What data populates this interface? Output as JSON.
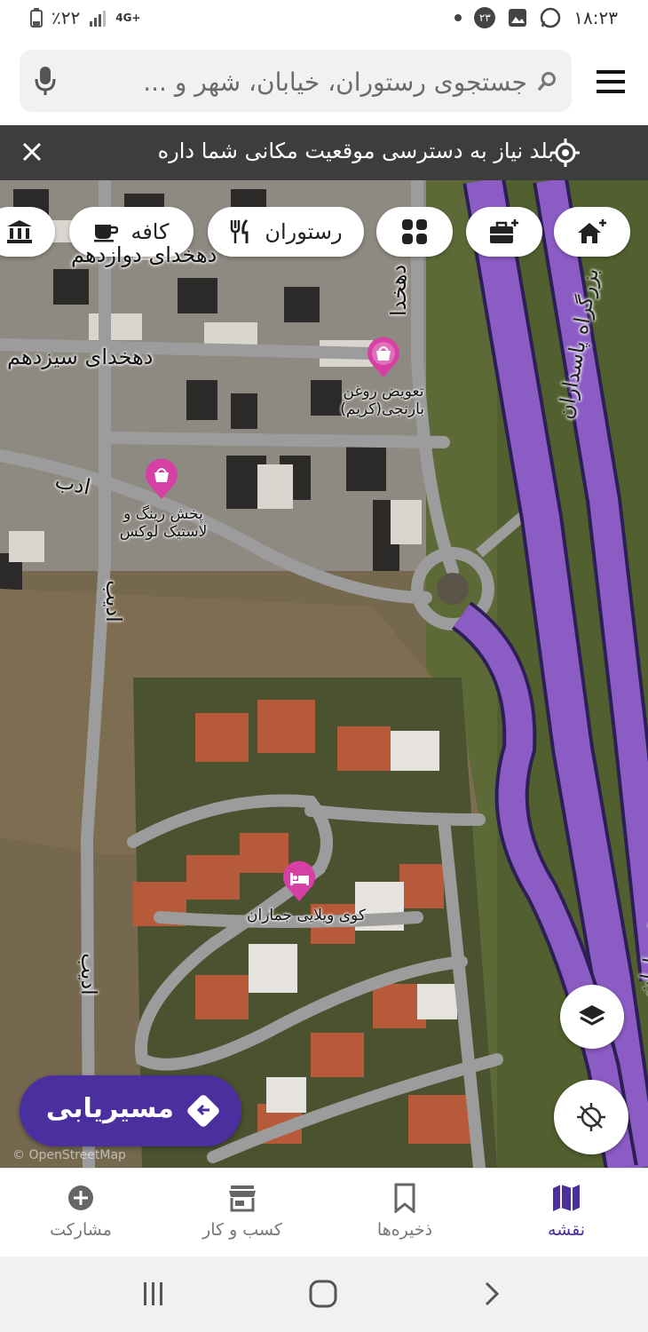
{
  "status_bar": {
    "time": "۱۸:۲۳",
    "notification_count": "۲۳",
    "battery": "٪۲۲",
    "network": "4G+"
  },
  "search": {
    "placeholder": "جستجوی رستوران، خیابان، شهر و ..."
  },
  "banner": {
    "message": "بلد نیاز به دسترسی موقعیت مکانی شما داره"
  },
  "categories": [
    {
      "label": "کافه",
      "icon": "coffee-icon"
    },
    {
      "label": "رستوران",
      "icon": "fork-knife-icon"
    }
  ],
  "map": {
    "labels": {
      "dehkhoda_13": "دهخدای سیزدهم",
      "dehkhoda_partial": "دهخدای دوازدهم",
      "dehkhoda_vertical": "دهخدا",
      "adab": "ادب",
      "adib1": "ادیب",
      "adib2": "ادیب",
      "highway": "بزرگراه پاسداران",
      "highway_right": "پاسداران"
    },
    "pois": [
      {
        "name": "تعویض روغن بارنجی(کریم)",
        "type": "shop"
      },
      {
        "name": "پخش رینگ و لاستیک لوکس",
        "type": "shop"
      },
      {
        "name": "کوی ویلایی جماران",
        "type": "hotel"
      }
    ],
    "watermark": "© OpenStreetMap"
  },
  "route_button": {
    "label": "مسیریابی"
  },
  "bottom_nav": [
    {
      "label": "نقشه",
      "active": true
    },
    {
      "label": "ذخیره‌ها",
      "active": false
    },
    {
      "label": "کسب و کار",
      "active": false
    },
    {
      "label": "مشارکت",
      "active": false
    }
  ],
  "colors": {
    "brand": "#4c2f9f",
    "highway": "#8b5cc4"
  }
}
